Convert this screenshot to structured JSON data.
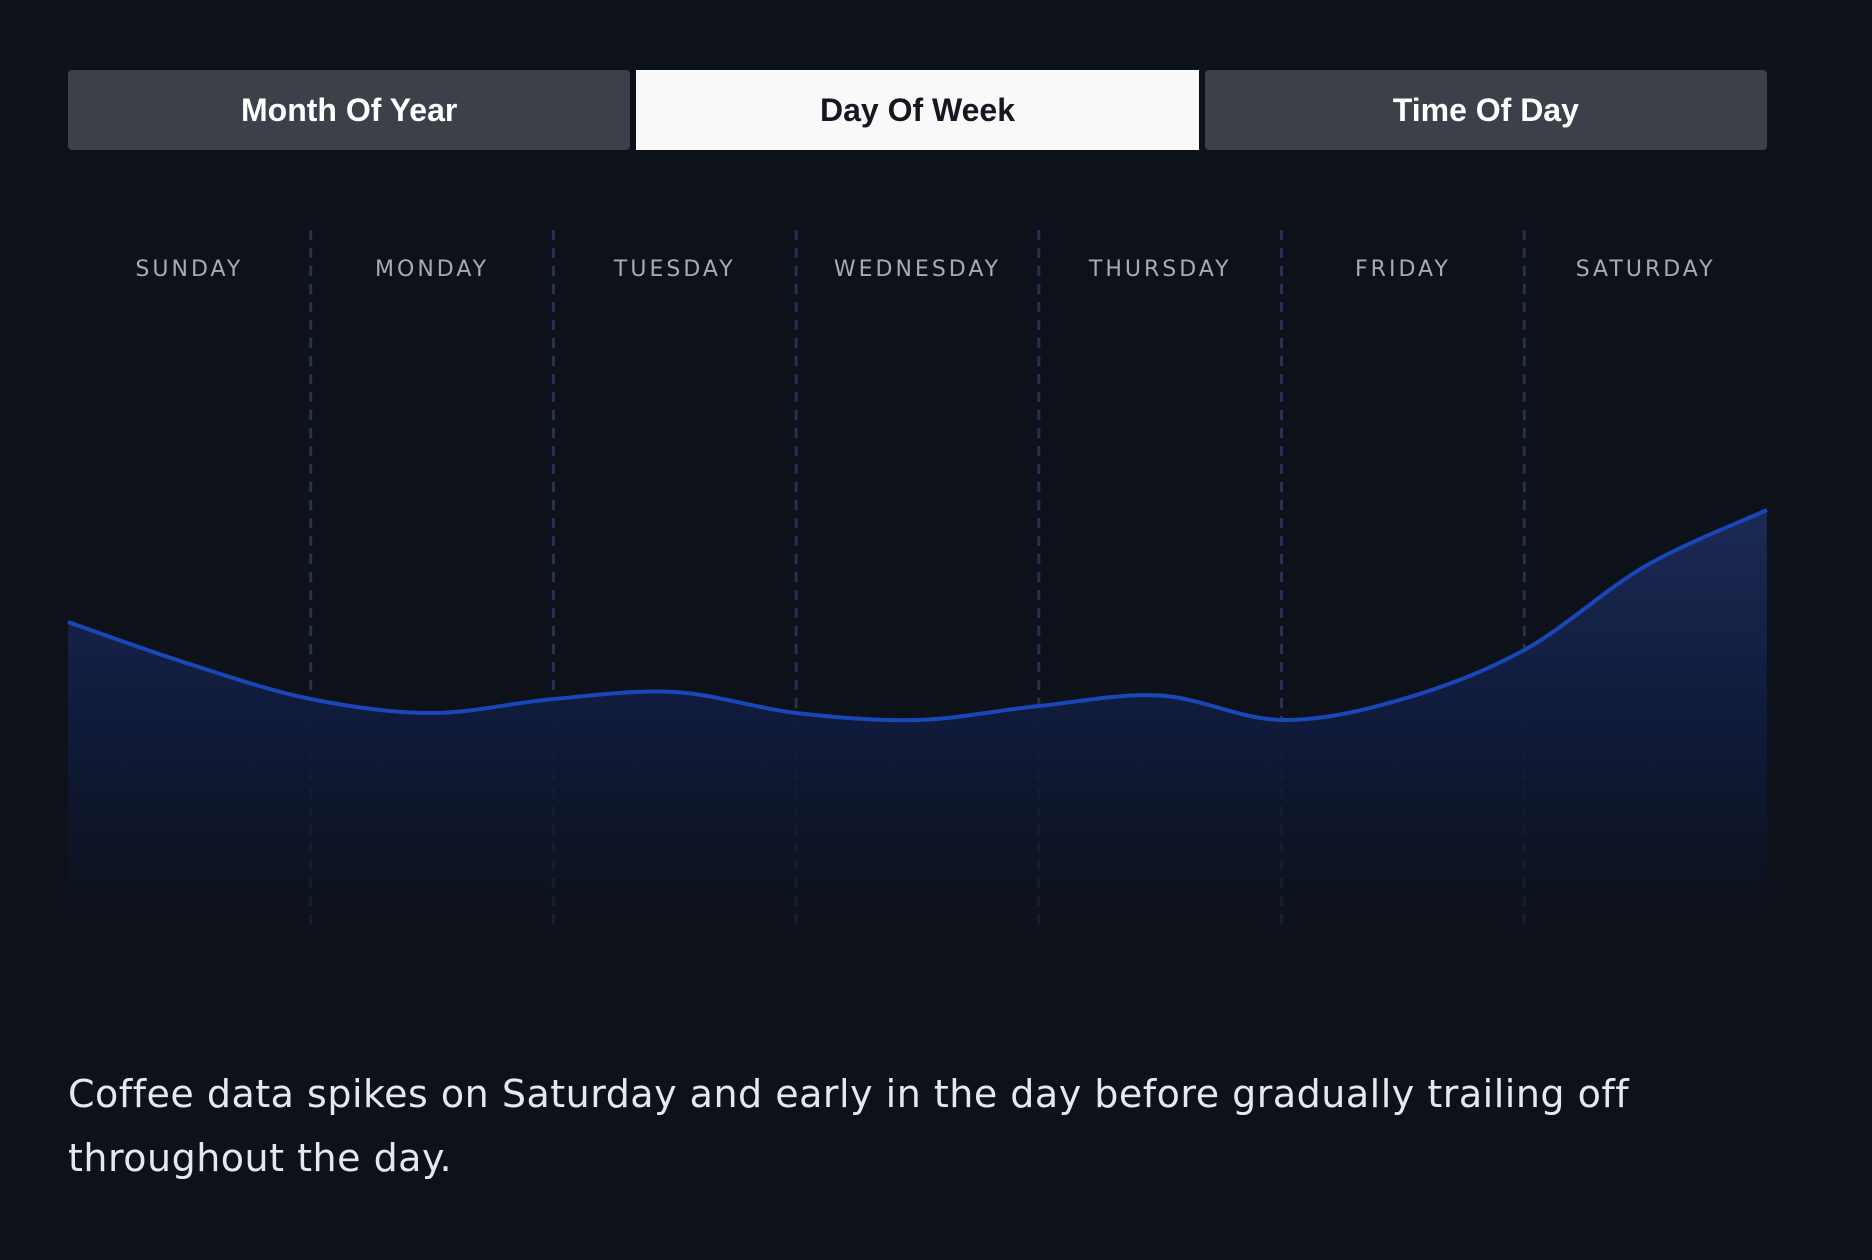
{
  "tabs": [
    {
      "label": "Month Of Year",
      "active": false
    },
    {
      "label": "Day Of Week",
      "active": true
    },
    {
      "label": "Time Of Day",
      "active": false
    }
  ],
  "colors": {
    "background": "#0d111a",
    "tab_inactive": "#3c4049",
    "tab_active": "#f9f9f9",
    "line": "#1a47b8",
    "area_top": "#1b2a55",
    "gridline": "#263251"
  },
  "chart_data": {
    "type": "area",
    "categories": [
      "SUNDAY",
      "MONDAY",
      "TUESDAY",
      "WEDNESDAY",
      "THURSDAY",
      "FRIDAY",
      "SATURDAY"
    ],
    "x": [
      0,
      0.5,
      1,
      1.5,
      2,
      2.5,
      3,
      3.5,
      4,
      4.5,
      5,
      5.5,
      6,
      6.5,
      7
    ],
    "values": [
      44,
      38,
      33,
      31,
      33,
      34,
      31,
      30,
      32,
      33.5,
      30,
      33,
      40,
      52,
      60
    ],
    "ylim": [
      0,
      100
    ],
    "grid": "vertical dashed separators between days",
    "title": "",
    "xlabel": "",
    "ylabel": ""
  },
  "caption": "Coffee data spikes on Saturday and early in the day before gradually trailing off throughout the day."
}
